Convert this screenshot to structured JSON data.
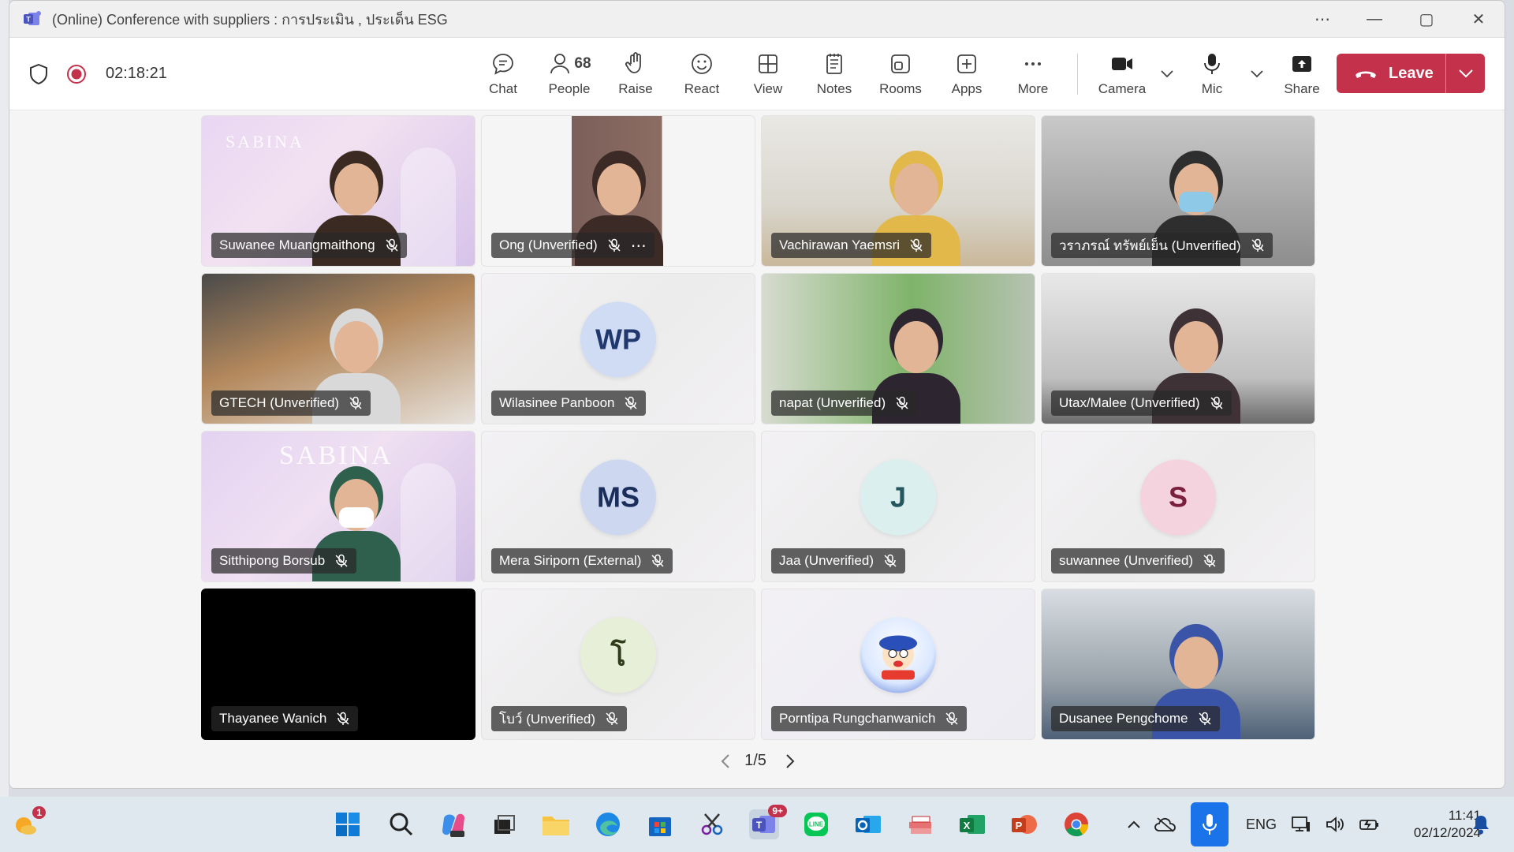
{
  "window": {
    "title": "(Online) Conference with suppliers : การประเมิน , ประเด็น ESG"
  },
  "toolbar": {
    "timer": "02:18:21",
    "buttons": {
      "chat": "Chat",
      "people": "People",
      "people_count": "68",
      "raise": "Raise",
      "react": "React",
      "view": "View",
      "notes": "Notes",
      "rooms": "Rooms",
      "apps": "Apps",
      "more": "More",
      "camera": "Camera",
      "mic": "Mic",
      "share": "Share",
      "leave": "Leave"
    }
  },
  "participants": [
    {
      "name": "Suwanee Muangmaithong",
      "type": "video",
      "scene": "sabina"
    },
    {
      "name": "Ong (Unverified)",
      "type": "video",
      "scene": "portrait"
    },
    {
      "name": "Vachirawan Yaemsri",
      "type": "video",
      "scene": "office"
    },
    {
      "name": "วราภรณ์ ทรัพย์เย็น (Unverified)",
      "type": "video",
      "scene": "mask"
    },
    {
      "name": "GTECH (Unverified)",
      "type": "video",
      "scene": "meeting"
    },
    {
      "name": "Wilasinee Panboon",
      "type": "avatar",
      "initials": "WP"
    },
    {
      "name": "napat (Unverified)",
      "type": "video",
      "scene": "green"
    },
    {
      "name": "Utax/Malee (Unverified)",
      "type": "video",
      "scene": "room"
    },
    {
      "name": "Sitthipong Borsub",
      "type": "video",
      "scene": "sabina2"
    },
    {
      "name": "Mera Siriporn (External)",
      "type": "avatar",
      "initials": "MS"
    },
    {
      "name": "Jaa (Unverified)",
      "type": "avatar",
      "initials": "J"
    },
    {
      "name": "suwannee (Unverified)",
      "type": "avatar",
      "initials": "S"
    },
    {
      "name": "Thayanee Wanich",
      "type": "black"
    },
    {
      "name": "โบว์ (Unverified)",
      "type": "avatar",
      "initials": "โ"
    },
    {
      "name": "Porntipa Rungchanwanich",
      "type": "cartoon"
    },
    {
      "name": "Dusanee Pengchome",
      "type": "video",
      "scene": "office2"
    }
  ],
  "pager": {
    "text": "1/5"
  },
  "taskbar": {
    "language": "ENG",
    "time": "11:41",
    "date": "02/12/2024",
    "weather_badge": "1",
    "teams_badge": "9+"
  },
  "colors": {
    "leave": "#c4314b",
    "record": "#c4314b"
  }
}
